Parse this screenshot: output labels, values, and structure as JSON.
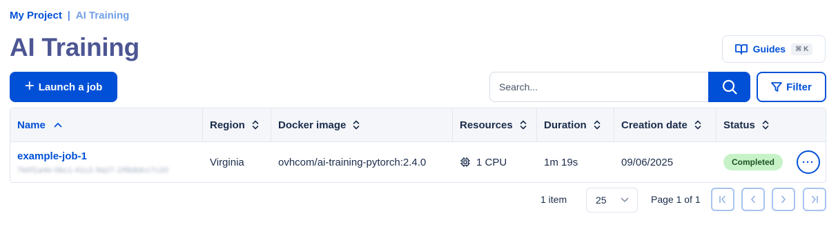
{
  "breadcrumb": {
    "root": "My Project",
    "separator": "|",
    "current": "AI Training"
  },
  "page_title": "AI Training",
  "guides": {
    "label": "Guides",
    "shortcut": "⌘ K"
  },
  "launch_button": {
    "label": "Launch a job"
  },
  "search": {
    "placeholder": "Search..."
  },
  "filter_button": {
    "label": "Filter"
  },
  "table": {
    "columns": [
      "Name",
      "Region",
      "Docker image",
      "Resources",
      "Duration",
      "Creation date",
      "Status"
    ],
    "rows": [
      {
        "name": "example-job-1",
        "id": "7b0f1a4e-0bc1-41c2-9a27-1f6b8dcc7c20",
        "region": "Virginia",
        "docker_image": "ovhcom/ai-training-pytorch:2.4.0",
        "resources": "1 CPU",
        "duration": "1m 19s",
        "creation_date": "09/06/2025",
        "status": "Completed"
      }
    ]
  },
  "pagination": {
    "count": "1 item",
    "page_size": "25",
    "page_label": "Page 1 of 1"
  },
  "colors": {
    "primary": "#0050d7",
    "title": "#4d5693",
    "status_completed_bg": "#c7f2c8"
  }
}
